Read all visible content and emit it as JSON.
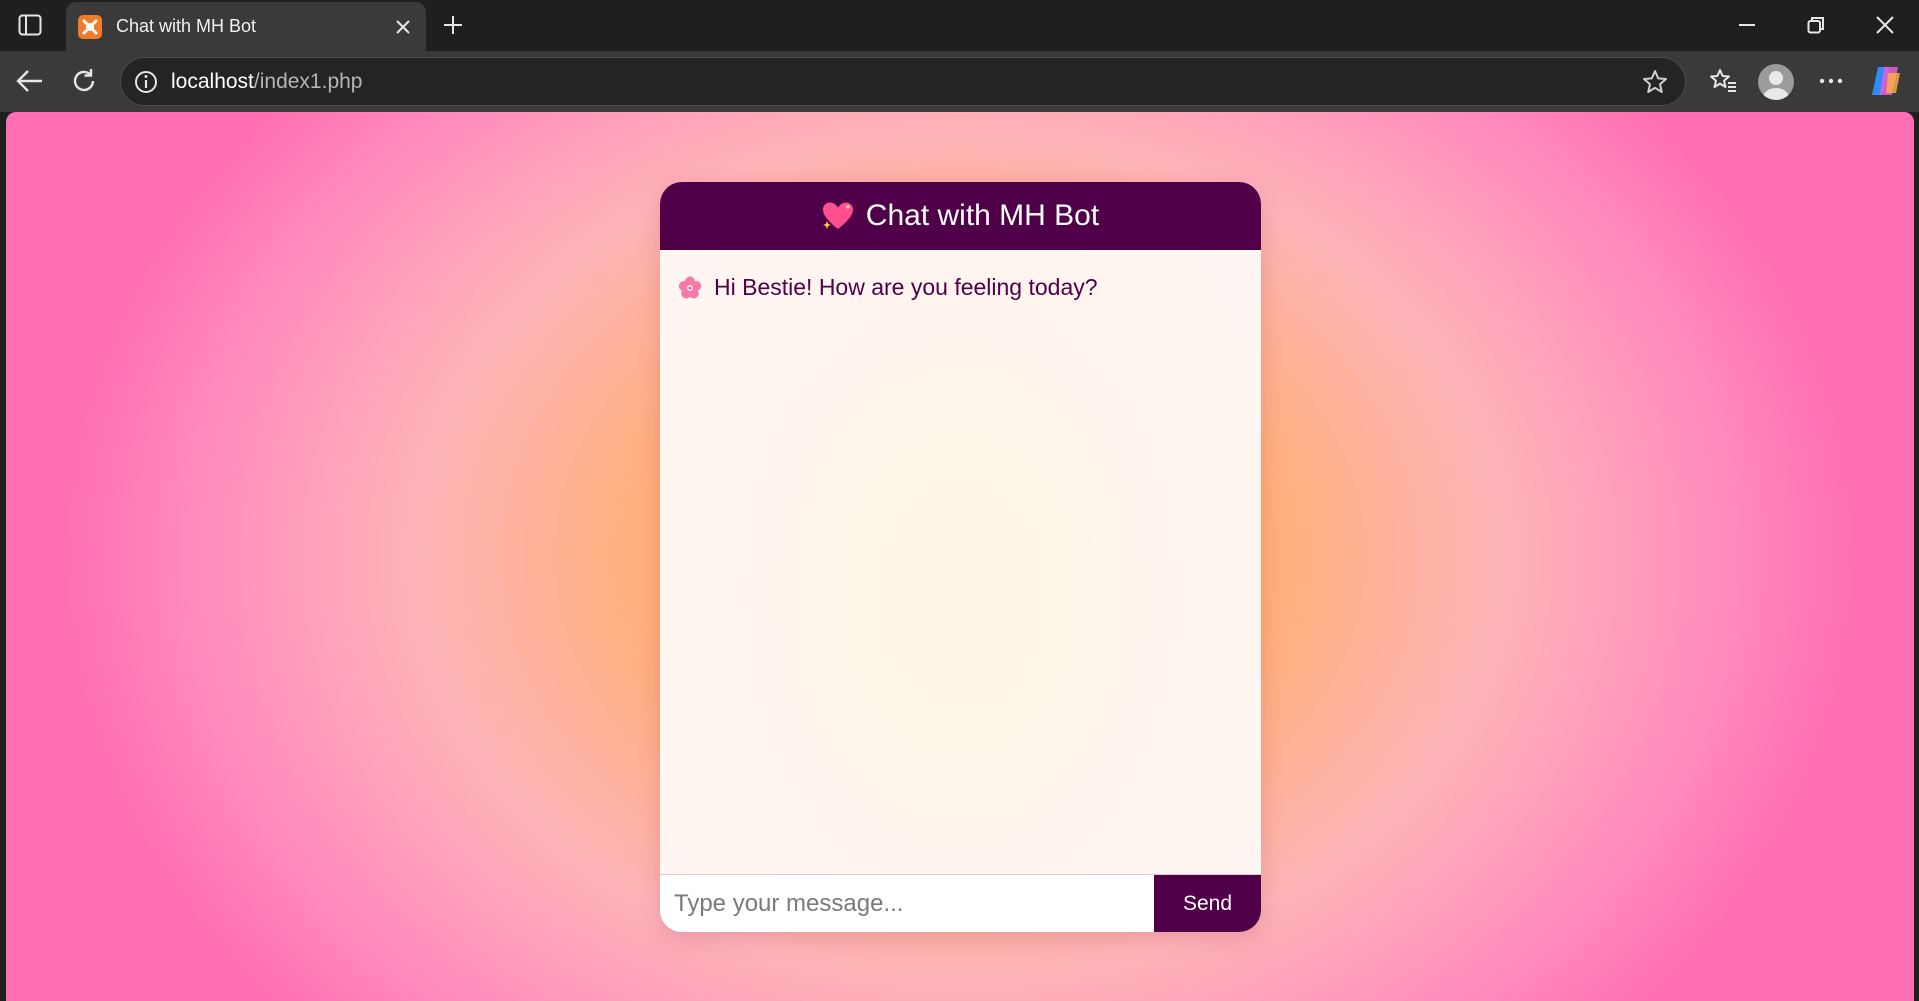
{
  "browser": {
    "tab": {
      "title": "Chat with MH Bot",
      "favicon": "xampp-icon"
    },
    "address": {
      "host": "localhost",
      "path": "/index1.php"
    },
    "icons": {
      "sidebar": "tab-sidebar-icon",
      "close_tab": "close-icon",
      "new_tab": "plus-icon",
      "back": "back-arrow-icon",
      "reload": "reload-icon",
      "info": "site-info-icon",
      "favorite": "star-icon",
      "favorites": "favorites-icon",
      "profile": "profile-icon",
      "more": "more-icon",
      "copilot": "copilot-icon",
      "minimize": "minimize-icon",
      "restore": "restore-icon",
      "close_window": "close-icon"
    }
  },
  "chat": {
    "header": {
      "emoji": "sparkling-heart-icon",
      "title": "Chat with MH Bot"
    },
    "messages": [
      {
        "sender": "bot",
        "emoji": "cherry-blossom-icon",
        "text": "Hi Bestie! How are you feeling today?"
      }
    ],
    "input": {
      "placeholder": "Type your message...",
      "value": ""
    },
    "send_label": "Send",
    "colors": {
      "accent": "#4f0049",
      "page_pink": "#ff6fb2",
      "page_orange": "#fdb36c"
    }
  }
}
